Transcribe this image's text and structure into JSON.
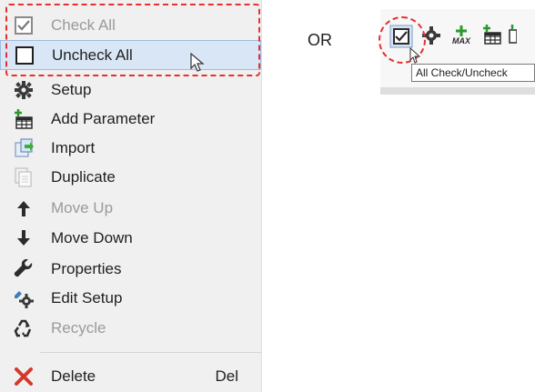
{
  "menu": {
    "items": [
      {
        "label": "Check All",
        "icon": "checked-box-icon",
        "enabled": false
      },
      {
        "label": "Uncheck All",
        "icon": "unchecked-box-icon",
        "enabled": true,
        "highlighted": true
      },
      {
        "label": "Setup",
        "icon": "gear-icon",
        "enabled": true
      },
      {
        "label": "Add Parameter",
        "icon": "add-table-icon",
        "enabled": true
      },
      {
        "label": "Import",
        "icon": "import-icon",
        "enabled": true
      },
      {
        "label": "Duplicate",
        "icon": "duplicate-icon",
        "enabled": true
      },
      {
        "label": "Move Up",
        "icon": "arrow-up-icon",
        "enabled": false
      },
      {
        "label": "Move Down",
        "icon": "arrow-down-icon",
        "enabled": true
      },
      {
        "label": "Properties",
        "icon": "wrench-icon",
        "enabled": true
      },
      {
        "label": "Edit Setup",
        "icon": "edit-gear-icon",
        "enabled": true
      },
      {
        "label": "Recycle",
        "icon": "recycle-icon",
        "enabled": false
      },
      {
        "label": "Delete",
        "icon": "delete-icon",
        "enabled": true,
        "shortcut": "Del"
      }
    ]
  },
  "separator_text": "OR",
  "toolbar": {
    "icons": [
      "check-all-icon",
      "gear-icon",
      "add-max-icon",
      "add-table-icon"
    ],
    "max_text": "MAX",
    "tooltip": "All Check/Uncheck"
  },
  "colors": {
    "highlight": "#d9e6f5",
    "annotation": "#e53030"
  }
}
